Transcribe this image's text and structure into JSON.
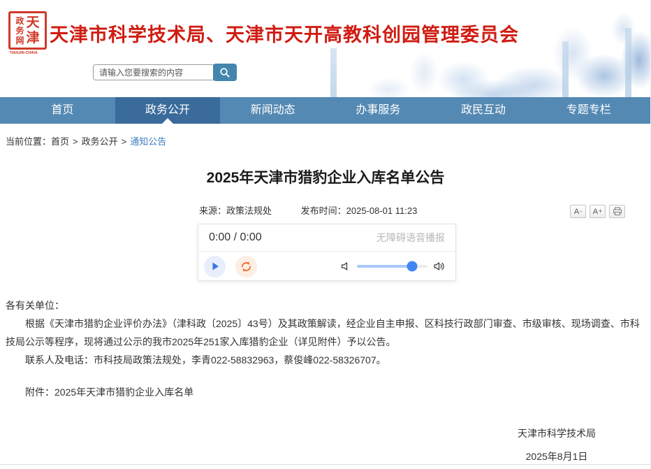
{
  "header": {
    "seal": {
      "left_chars": [
        "政",
        "务",
        "网"
      ],
      "right_chars": [
        "天",
        "津"
      ],
      "caption": "TIANJIN-CHINA"
    },
    "title": "天津市科学技术局、天津市天开高教科创园管理委员会",
    "search_placeholder": "请输入您要搜索的内容"
  },
  "nav": {
    "items": [
      {
        "label": "首页",
        "active": false
      },
      {
        "label": "政务公开",
        "active": true
      },
      {
        "label": "新闻动态",
        "active": false
      },
      {
        "label": "办事服务",
        "active": false
      },
      {
        "label": "政民互动",
        "active": false
      },
      {
        "label": "专题专栏",
        "active": false
      }
    ]
  },
  "breadcrumb": {
    "prefix": "当前位置：",
    "home": "首页",
    "sep": ">",
    "section": "政务公开",
    "current": "通知公告"
  },
  "article": {
    "title": "2025年天津市猎豹企业入库名单公告",
    "source": "来源：政策法规处",
    "publish": "发布时间：2025-08-01 11:23",
    "tools": {
      "font_base": "A",
      "font_decrease_sign": "-",
      "font_increase_sign": "+"
    }
  },
  "player": {
    "time": "0:00 / 0:00",
    "caption": "无障碍语音播报",
    "volume_percent": 78
  },
  "content": {
    "salutation": "各有关单位：",
    "paragraph_main": "根据《天津市猎豹企业评价办法》（津科政〔2025〕43号）及其政策解读，经企业自主申报、区科技行政部门审查、市级审核、现场调查、市科技局公示等程序，现将通过公示的我市2025年251家入库猎豹企业（详见附件）予以公告。",
    "paragraph_contact": "联系人及电话：市科技局政策法规处，李青022-58832963，蔡俊峰022-58326707。",
    "attachment": "附件：2025年天津市猎豹企业入库名单"
  },
  "footer": {
    "org": "天津市科学技术局",
    "date": "2025年8月1日"
  },
  "colors": {
    "accent_red": "#cf1c12",
    "nav_blue": "#5489b3",
    "nav_active_blue": "#3a6b9b",
    "link_blue": "#3e7cc0",
    "play_blue": "#3b77e3",
    "replay_orange": "#f2672a",
    "slider_fill": "#a8c7fa",
    "slider_thumb": "#4285f4"
  }
}
